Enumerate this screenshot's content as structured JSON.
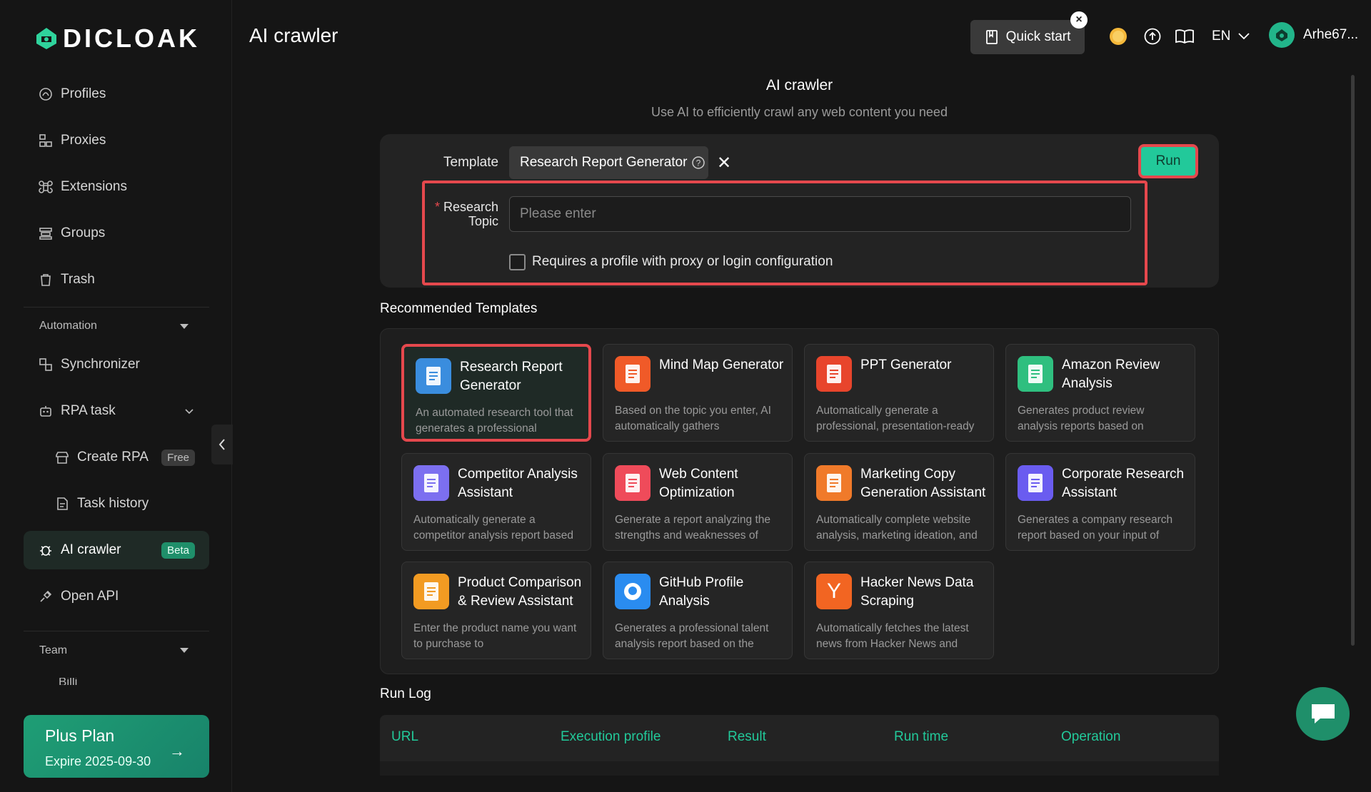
{
  "app": {
    "brand": "DICLOAK",
    "page_title": "AI crawler"
  },
  "topbar": {
    "quick_start": "Quick start",
    "lang": "EN",
    "user": "Arhe67..."
  },
  "sidebar": {
    "items": [
      {
        "label": "Profiles",
        "icon": "fingerprint-icon"
      },
      {
        "label": "Proxies",
        "icon": "network-icon"
      },
      {
        "label": "Extensions",
        "icon": "command-icon"
      },
      {
        "label": "Groups",
        "icon": "layers-icon"
      },
      {
        "label": "Trash",
        "icon": "trash-icon"
      }
    ],
    "automation_label": "Automation",
    "automation_items": [
      {
        "label": "Synchronizer"
      },
      {
        "label": "RPA task"
      },
      {
        "label": "Create RPA",
        "badge": "Free"
      },
      {
        "label": "Task history"
      },
      {
        "label": "AI crawler",
        "badge": "Beta"
      },
      {
        "label": "Open API"
      }
    ],
    "team_label": "Team",
    "team_partial": "Billi",
    "plan": {
      "title": "Plus Plan",
      "expire": "Expire 2025-09-30"
    }
  },
  "main": {
    "title": "AI crawler",
    "subtitle": "Use AI to efficiently crawl any web content you need",
    "template_label": "Template",
    "template_value": "Research Report Generator",
    "run_label": "Run",
    "topic_label_1": "Research",
    "topic_label_2": "Topic",
    "topic_placeholder": "Please enter",
    "checkbox_label": "Requires a profile with proxy or login configuration",
    "rec_title": "Recommended Templates",
    "templates": [
      {
        "title": "Research Report Generator",
        "desc": "An automated research tool that generates a professional",
        "color": "#3a8dde"
      },
      {
        "title": "Mind Map Generator",
        "desc": "Based on the topic you enter, AI automatically gathers",
        "color": "#f05a28"
      },
      {
        "title": "PPT Generator",
        "desc": "Automatically generate a professional, presentation-ready",
        "color": "#e8452c"
      },
      {
        "title": "Amazon Review Analysis",
        "desc": "Generates product review analysis reports based on",
        "color": "#2fbf7f"
      },
      {
        "title": "Competitor Analysis Assistant",
        "desc": "Automatically generate a competitor analysis report based",
        "color": "#7c6ff0"
      },
      {
        "title": "Web Content Optimization",
        "desc": "Generate a report analyzing the strengths and weaknesses of",
        "color": "#ef4b5a"
      },
      {
        "title": "Marketing Copy Generation Assistant",
        "desc": "Automatically complete website analysis, marketing ideation, and",
        "color": "#f07a2a"
      },
      {
        "title": "Corporate Research Assistant",
        "desc": "Generates a company research report based on your input of",
        "color": "#6a5cf0"
      },
      {
        "title": "Product Comparison & Review Assistant",
        "desc": "Enter the product name you want to purchase to",
        "color": "#f29b22"
      },
      {
        "title": "GitHub Profile Analysis",
        "desc": "Generates a professional talent analysis report based on the",
        "color": "#2a8cf0"
      },
      {
        "title": "Hacker News Data Scraping",
        "desc": "Automatically fetches the latest news from Hacker News and",
        "color": "#f26522"
      }
    ],
    "runlog_title": "Run Log",
    "runlog_columns": [
      "URL",
      "Execution profile",
      "Result",
      "Run time",
      "Operation"
    ]
  },
  "colors": {
    "accent": "#22c99a",
    "highlight": "#e5484d"
  }
}
